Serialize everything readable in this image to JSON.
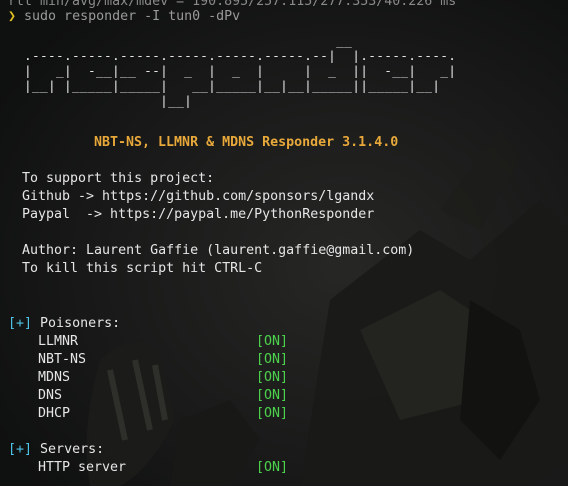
{
  "terminal": {
    "top_partial": "rtt min/avg/max/mdev = 190.895/257.115/277.353/40.226 ms",
    "prompt_symbol": "❯",
    "command": "sudo responder -I tun0 -dPv",
    "ascii_banner": [
      "                                         __",
      "  .----.-----.-----.-----.-----.-----.--|  |.-----.----.",
      "  |   _|  -__|__ --|  _  |  _  |     |  _  ||  -__|   _|",
      "  |__| |_____|_____|   __|_____|__|__|_____||_____|__|",
      "                   |__|"
    ],
    "title": "NBT-NS, LLMNR & MDNS Responder 3.1.4.0",
    "support_heading": "To support this project:",
    "github_line": "Github -> https://github.com/sponsors/lgandx",
    "paypal_line": "Paypal  -> https://paypal.me/PythonResponder",
    "author_line": "Author: Laurent Gaffie (laurent.gaffie@gmail.com)",
    "kill_line": "To kill this script hit CTRL-C",
    "poisoners_marker": "[+]",
    "poisoners_heading": "Poisoners:",
    "poisoners": [
      {
        "name": "LLMNR",
        "status": "[ON]"
      },
      {
        "name": "NBT-NS",
        "status": "[ON]"
      },
      {
        "name": "MDNS",
        "status": "[ON]"
      },
      {
        "name": "DNS",
        "status": "[ON]"
      },
      {
        "name": "DHCP",
        "status": "[ON]"
      }
    ],
    "servers_marker": "[+]",
    "servers_heading": "Servers:",
    "servers": [
      {
        "name": "HTTP server",
        "status": "[ON]"
      }
    ]
  },
  "colors": {
    "background": "#0f1010",
    "prompt": "#e0c020",
    "title": "#e8a83a",
    "marker": "#4fc3e8",
    "status_on": "#4cd24c"
  }
}
